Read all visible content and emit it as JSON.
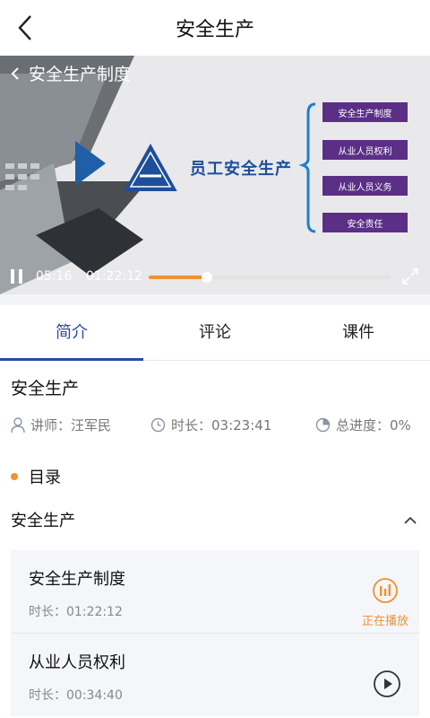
{
  "header": {
    "title": "安全生产"
  },
  "video": {
    "title": "安全生产制度",
    "slide_heading": "员工安全生产",
    "outline": [
      "安全生产制度",
      "从业人员权利",
      "从业人员义务",
      "安全责任"
    ],
    "current_time": "05:16",
    "total_time": "01:22:12",
    "progress": 0.24
  },
  "tabs": [
    {
      "label": "简介",
      "active": true
    },
    {
      "label": "评论",
      "active": false
    },
    {
      "label": "课件",
      "active": false
    }
  ],
  "course": {
    "title": "安全生产",
    "teacher": "讲师：汪军民",
    "duration": "时长：03:23:41",
    "progress": "总进度：0%"
  },
  "catalog": {
    "label": "目录"
  },
  "section": {
    "title": "安全生产"
  },
  "lessons": [
    {
      "name": "安全生产制度",
      "duration": "时长：01:22:12",
      "status": "正在播放"
    },
    {
      "name": "从业人员权利",
      "duration": "时长：00:34:40",
      "status": ""
    }
  ],
  "colors": {
    "accent": "#2b4aa6",
    "orange": "#ef9232",
    "slide_purple": "#5b2f86",
    "slide_blue": "#1f4e9a"
  },
  "icons": [
    "back-arrow-icon",
    "chevron-left-icon",
    "pause-icon",
    "fullscreen-icon",
    "user-icon",
    "clock-icon",
    "pie-chart-icon",
    "chevron-up-icon",
    "playing-bars-icon",
    "play-circle-icon"
  ]
}
